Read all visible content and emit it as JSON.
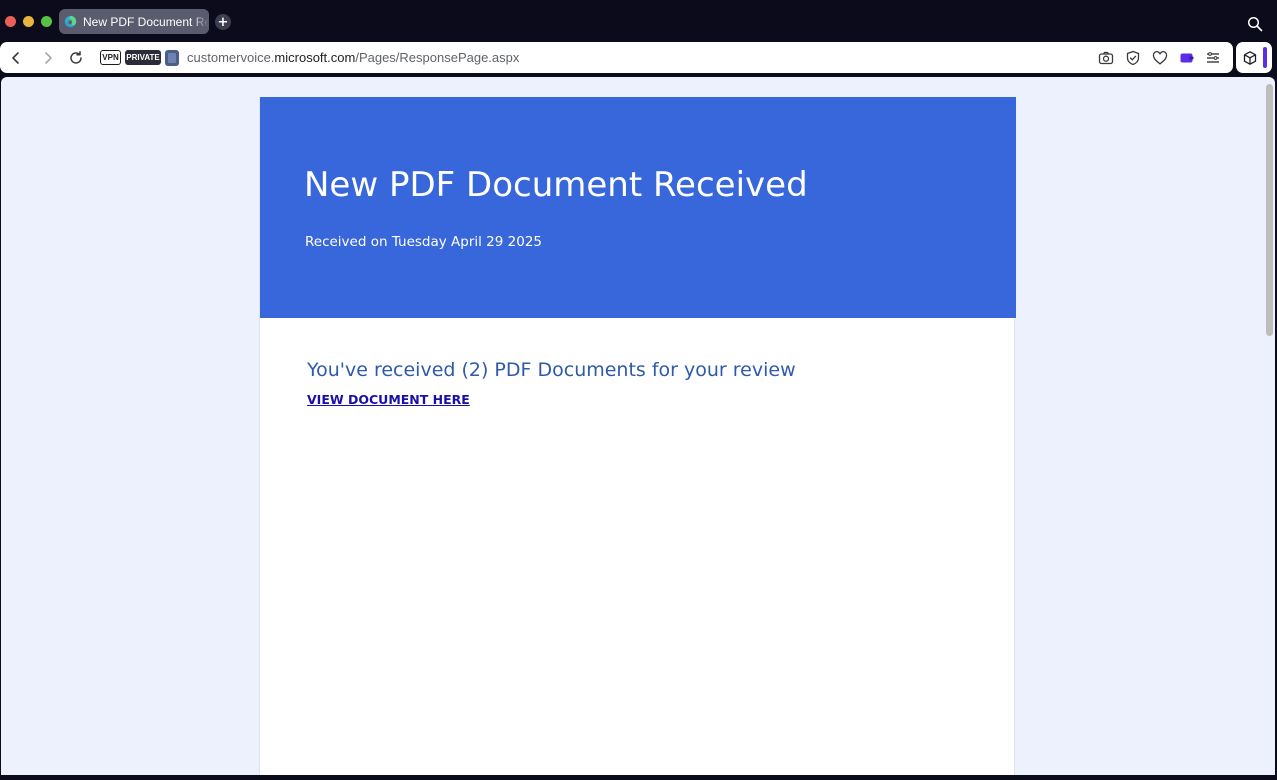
{
  "browser": {
    "tab": {
      "title": "New PDF Document Received",
      "favicon": "edge-swirl-icon"
    },
    "toolbar": {
      "vpn_label": "VPN",
      "private_label": "PRIVATE",
      "url_prefix": "customervoice.",
      "url_host": "microsoft.com",
      "url_path": "/Pages/ResponsePage.aspx"
    },
    "icons": [
      "back-icon",
      "forward-icon",
      "reload-icon",
      "camera-icon",
      "shield-check-icon",
      "heart-icon",
      "wallet-icon",
      "menu-icon",
      "cube-icon",
      "search-icon",
      "plus-icon"
    ],
    "colors": {
      "accent": "#5b2ee6",
      "chrome": "#0b0b1c"
    }
  },
  "page": {
    "hero": {
      "title": "New PDF Document Received",
      "subtitle": "Received on Tuesday April 29 2025"
    },
    "body": {
      "heading": "You've received (2) PDF Documents for your review",
      "link_text": "VIEW DOCUMENT HERE"
    },
    "colors": {
      "hero_bg": "#3767db",
      "heading": "#2f5aa8",
      "link": "#1a0fa8",
      "page_bg": "#ecf1fd"
    }
  }
}
